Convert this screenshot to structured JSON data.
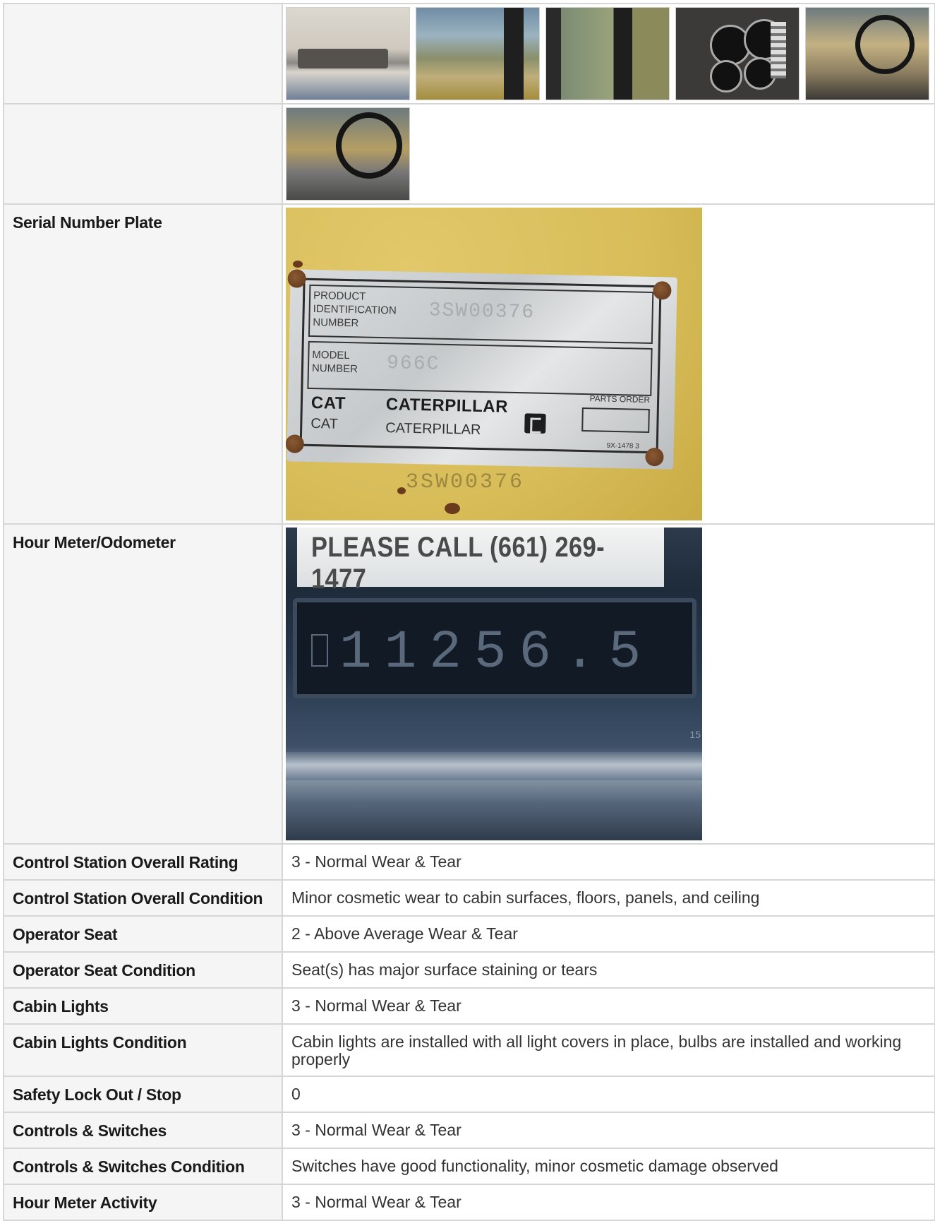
{
  "rows": {
    "serial_number_plate": {
      "label": "Serial Number Plate",
      "plate": {
        "pin_label_1": "PRODUCT",
        "pin_label_2": "IDENTIFICATION",
        "pin_label_3": "NUMBER",
        "pin_value": "3SW00376",
        "model_label_1": "MODEL",
        "model_label_2": "NUMBER",
        "model_value": "966C",
        "brand_cat": "CAT",
        "brand_caterpillar": "CATERPILLAR",
        "parts_order": "PARTS ORDER",
        "part_no": "9X-1478 3",
        "stencil": "3SW00376"
      }
    },
    "hour_meter": {
      "label": "Hour Meter/Odometer",
      "sign_text": "PLEASE CALL (661) 269-1477",
      "reading": "11256.5",
      "edge_mark": "15"
    }
  },
  "details": [
    {
      "label": "Control Station Overall Rating",
      "value": "3 - Normal Wear & Tear"
    },
    {
      "label": "Control Station Overall Condition",
      "value": "Minor cosmetic wear to cabin surfaces, floors, panels, and ceiling"
    },
    {
      "label": "Operator Seat",
      "value": "2 - Above Average Wear & Tear"
    },
    {
      "label": "Operator Seat Condition",
      "value": "Seat(s) has major surface staining or tears"
    },
    {
      "label": "Cabin Lights",
      "value": "3 - Normal Wear & Tear"
    },
    {
      "label": "Cabin Lights Condition",
      "value": "Cabin lights are installed with all light covers in place, bulbs are installed and working properly"
    },
    {
      "label": "Safety Lock Out / Stop",
      "value": "0"
    },
    {
      "label": "Controls & Switches",
      "value": "3 - Normal Wear & Tear"
    },
    {
      "label": "Controls & Switches Condition",
      "value": "Switches have good functionality, minor cosmetic damage observed"
    },
    {
      "label": "Hour Meter Activity",
      "value": "3 - Normal Wear & Tear"
    }
  ]
}
